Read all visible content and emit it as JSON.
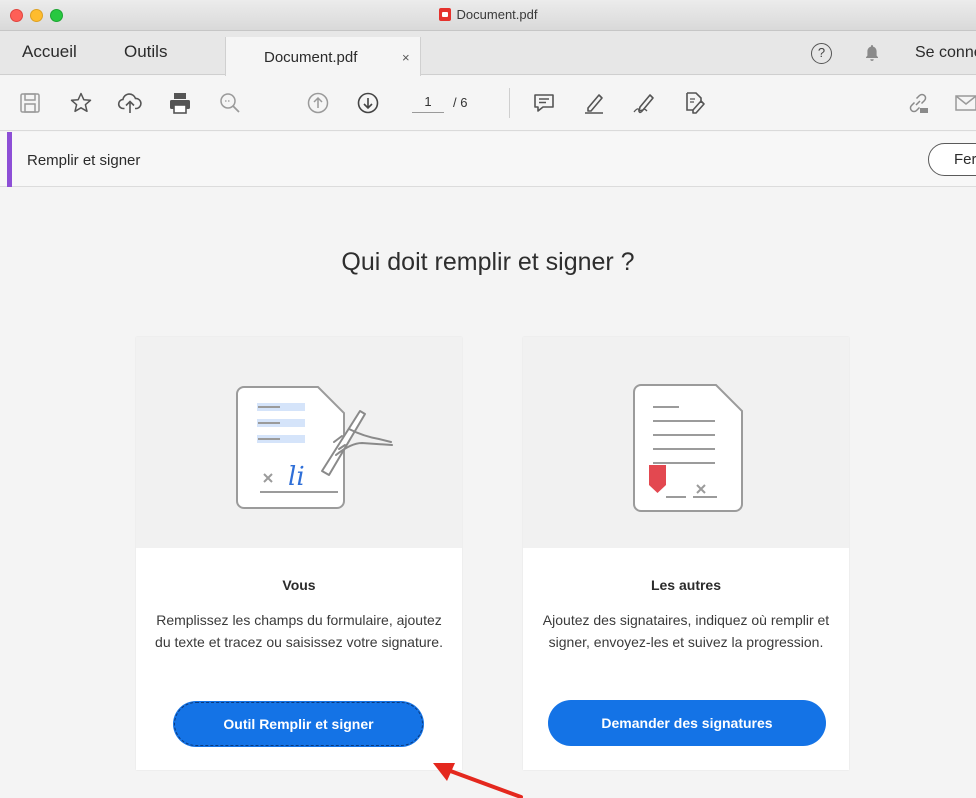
{
  "window": {
    "title": "Document.pdf"
  },
  "tabs": {
    "home": "Accueil",
    "tools": "Outils",
    "document": "Document.pdf",
    "close": "×",
    "help": "?",
    "signin": "Se connecter"
  },
  "toolbar": {
    "icons": [
      "save-icon",
      "star-icon",
      "upload-icon",
      "print-icon",
      "zoom-icon",
      "page-up-icon",
      "page-down-icon",
      "comment-icon",
      "highlight-icon",
      "sign-icon",
      "fill-form-icon",
      "link-icon",
      "mail-icon"
    ],
    "page_current": "1",
    "page_total": "/ 6"
  },
  "fill_sign_bar": {
    "title": "Remplir et signer",
    "close_label": "Fermer"
  },
  "main": {
    "heading": "Qui doit remplir et signer ?",
    "cards": [
      {
        "title": "Vous",
        "description": "Remplissez les champs du formulaire, ajoutez du texte et tracez ou saisissez votre signature.",
        "button": "Outil Remplir et signer"
      },
      {
        "title": "Les autres",
        "description": "Ajoutez des signataires, indiquez où remplir et signer, envoyez-les et suivez la progression.",
        "button": "Demander des signatures"
      }
    ]
  },
  "colors": {
    "accent_purple": "#8d4fd6",
    "button_blue": "#1473e6",
    "marker_red": "#e34850",
    "arrow_red": "#e4281e"
  }
}
